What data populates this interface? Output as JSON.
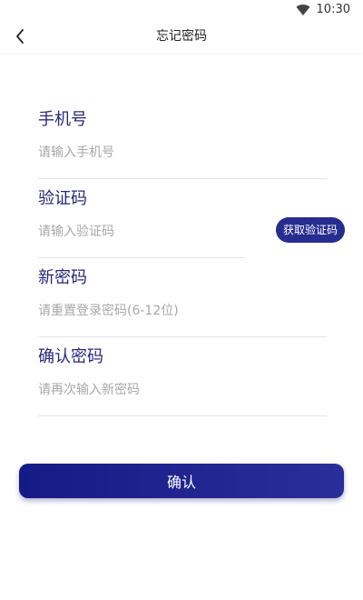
{
  "status_bar": {
    "time": "10:30",
    "icons": [
      "wifi-icon"
    ]
  },
  "app_bar": {
    "title": "忘记密码",
    "back_icon": "chevron-left-icon"
  },
  "form": {
    "phone": {
      "label": "手机号",
      "placeholder": "请输入手机号",
      "value": ""
    },
    "code": {
      "label": "验证码",
      "placeholder": "请输入验证码",
      "value": "",
      "button_label": "获取验证码"
    },
    "new_password": {
      "label": "新密码",
      "placeholder": "请重置登录密码(6-12位)",
      "value": ""
    },
    "confirm_password": {
      "label": "确认密码",
      "placeholder": "请再次输入新密码",
      "value": ""
    }
  },
  "confirm_button": {
    "label": "确认"
  },
  "colors": {
    "accent": "#272c8f",
    "label": "#24287a",
    "placeholder": "#a8a8a8",
    "divider": "#e6e6e6"
  }
}
